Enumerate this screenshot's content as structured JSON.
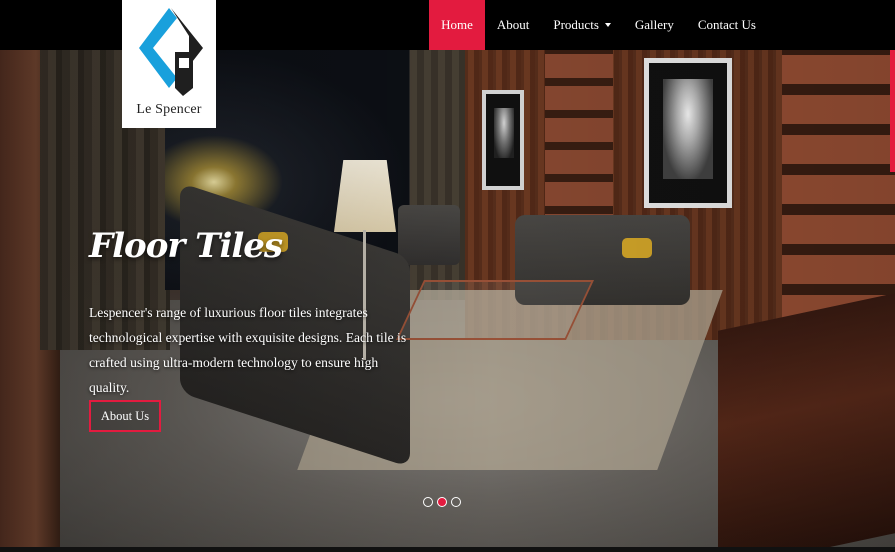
{
  "brand": {
    "name": "Le Spencer",
    "logo_colors": {
      "blue": "#19a0dc",
      "dark": "#1f1f1f"
    }
  },
  "nav": {
    "items": [
      {
        "label": "Home",
        "active": true
      },
      {
        "label": "About",
        "active": false
      },
      {
        "label": "Products",
        "active": false,
        "dropdown": true
      },
      {
        "label": "Gallery",
        "active": false
      },
      {
        "label": "Contact Us",
        "active": false
      }
    ],
    "active_color": "#e31b3f"
  },
  "hero": {
    "title": "Floor Tiles",
    "description": "Lespencer's range of luxurious floor tiles integrates technological expertise with exquisite designs. Each tile is crafted using ultra-modern technology to ensure high quality.",
    "button_label": "About Us",
    "slides": 3,
    "active_slide": 2
  },
  "colors": {
    "accent": "#e31b3f",
    "navbar": "#000000",
    "text": "#ffffff"
  }
}
